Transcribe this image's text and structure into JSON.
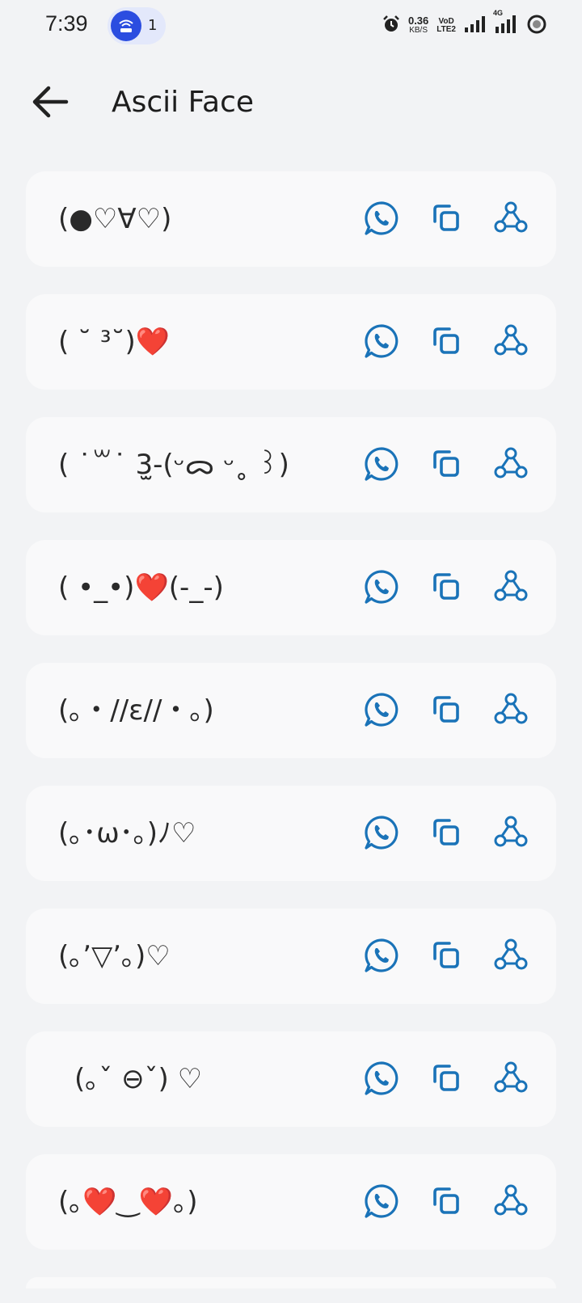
{
  "status": {
    "time": "7:39",
    "hotspot_count": "1",
    "speed_value": "0.36",
    "speed_unit": "KB/S",
    "volte_top": "VoD",
    "volte_bottom": "LTE2",
    "network_label": "4G"
  },
  "app_bar": {
    "title": "Ascii Face"
  },
  "faces": [
    "(●♡∀♡)",
    "( ˘ ³˘)❤️",
    "( ˙꒳˙ 3̫-(ᵕᯅ ᵕ˳ ꒱)",
    "( •_•)❤️(-_-)",
    "(｡・//ε//・｡)",
    "(｡･ω･｡)ﾉ♡",
    "(｡’▽’｡)♡",
    "(｡ˇ ⊖ˇ) ♡",
    "(｡❤️‿❤️｡)"
  ],
  "icons": {
    "whatsapp": "whatsapp-icon",
    "copy": "copy-icon",
    "share": "share-icon",
    "back": "back-arrow-icon"
  },
  "colors": {
    "accent": "#1a73b8",
    "background": "#f2f3f5",
    "card": "#f9f9fa",
    "hotspot": "#2b4de0"
  }
}
